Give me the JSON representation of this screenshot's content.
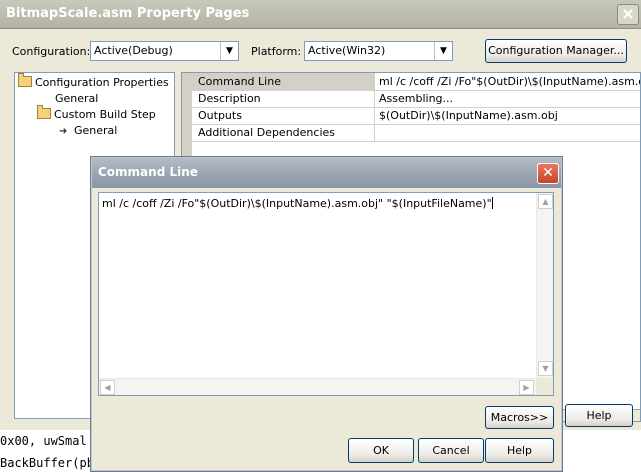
{
  "main_window": {
    "title": "BitmapScale.asm Property Pages",
    "configuration_label": "Configuration:",
    "configuration_value": "Active(Debug)",
    "platform_label": "Platform:",
    "platform_value": "Active(Win32)",
    "config_manager_label": "Configuration Manager...",
    "help_label": "Help"
  },
  "tree": {
    "items": [
      {
        "label": "Configuration Properties",
        "icon": "folder-open-icon"
      },
      {
        "label": "General"
      },
      {
        "label": "Custom Build Step",
        "icon": "folder-open-icon"
      },
      {
        "label": "General",
        "icon": "arrow-right-icon"
      }
    ]
  },
  "properties": {
    "rows": [
      {
        "name": "Command Line",
        "value": "ml /c /coff /Zi /Fo\"$(OutDir)\\$(InputName).asm.obj\" \""
      },
      {
        "name": "Description",
        "value": "Assembling..."
      },
      {
        "name": "Outputs",
        "value": "$(OutDir)\\$(InputName).asm.obj"
      },
      {
        "name": "Additional Dependencies",
        "value": ""
      }
    ]
  },
  "background_code": {
    "line1": "0x00, uwSmal",
    "line2": "BackBuffer(pb"
  },
  "command_dialog": {
    "title": "Command Line",
    "close_glyph": "✕",
    "text": "ml /c /coff /Zi /Fo\"$(OutDir)\\$(InputName).asm.obj\" \"$(InputFileName)\"",
    "macros_label": "Macros>>",
    "ok_label": "OK",
    "cancel_label": "Cancel",
    "help_label": "Help"
  },
  "colors": {
    "dialog_face": "#ece9d8",
    "close_red": "#c8452a",
    "field_border": "#7f9db9"
  }
}
